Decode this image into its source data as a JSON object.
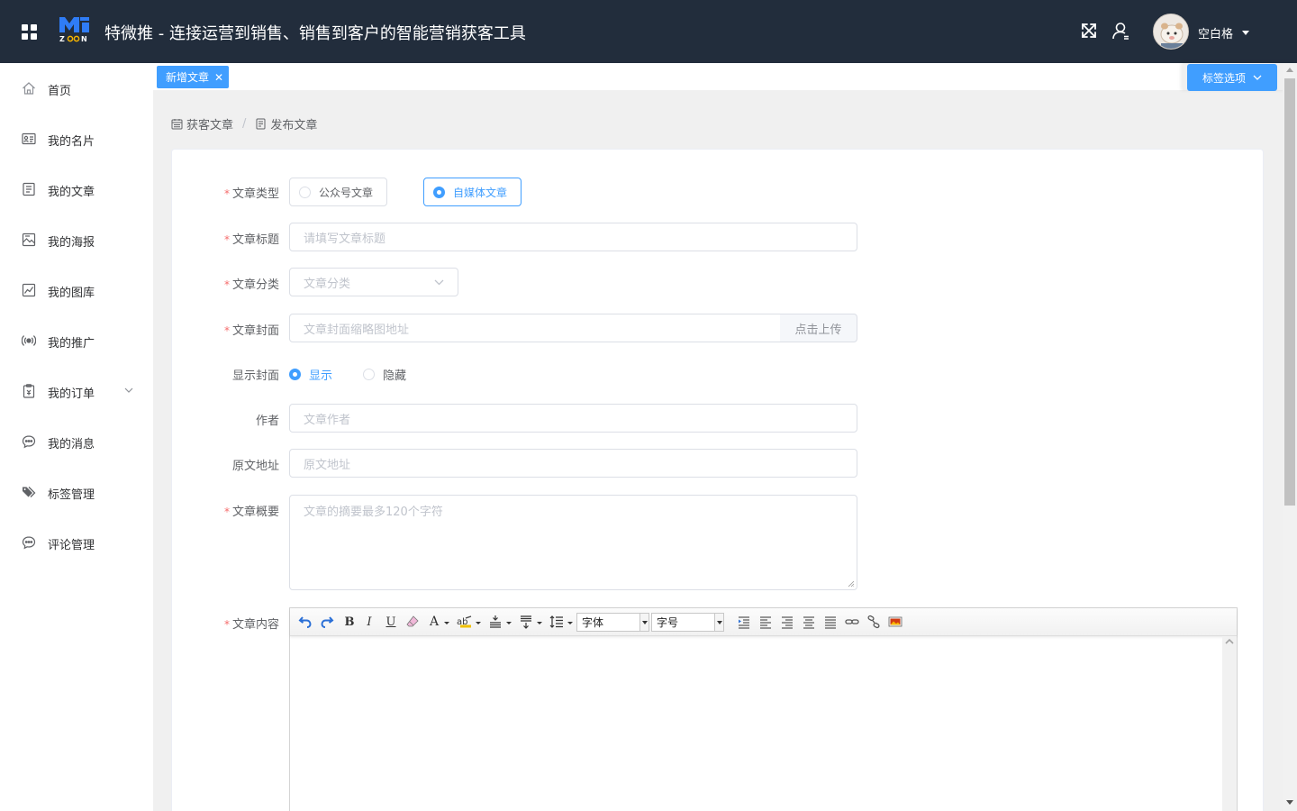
{
  "app": {
    "title": "特微推 - 连接运营到销售、销售到客户的智能营销获客工具",
    "username": "空白格"
  },
  "sidebar": {
    "items": [
      {
        "label": "首页",
        "icon": "home-icon"
      },
      {
        "label": "我的名片",
        "icon": "card-icon"
      },
      {
        "label": "我的文章",
        "icon": "document-icon"
      },
      {
        "label": "我的海报",
        "icon": "poster-icon"
      },
      {
        "label": "我的图库",
        "icon": "chart-icon"
      },
      {
        "label": "我的推广",
        "icon": "broadcast-icon"
      },
      {
        "label": "我的订单",
        "icon": "order-icon"
      },
      {
        "label": "我的消息",
        "icon": "message-icon"
      },
      {
        "label": "标签管理",
        "icon": "tag-icon"
      },
      {
        "label": "评论管理",
        "icon": "comment-icon"
      }
    ]
  },
  "tabs": {
    "active_label": "新增文章",
    "close_glyph": "✕",
    "options_label": "标签选项"
  },
  "breadcrumb": {
    "first": "获客文章",
    "separator": "/",
    "second": "发布文章"
  },
  "form": {
    "type_label": "文章类型",
    "type_options": [
      "公众号文章",
      "自媒体文章"
    ],
    "type_selected": "自媒体文章",
    "title_label": "文章标题",
    "title_placeholder": "请填写文章标题",
    "category_label": "文章分类",
    "category_placeholder": "文章分类",
    "cover_label": "文章封面",
    "cover_placeholder": "文章封面缩略图地址",
    "upload_label": "点击上传",
    "show_cover_label": "显示封面",
    "show_options": [
      "显示",
      "隐藏"
    ],
    "show_selected": "显示",
    "author_label": "作者",
    "author_placeholder": "文章作者",
    "source_label": "原文地址",
    "source_placeholder": "原文地址",
    "summary_label": "文章概要",
    "summary_placeholder": "文章的摘要最多120个字符",
    "content_label": "文章内容",
    "required_mark": "*"
  },
  "editor": {
    "font_family_label": "字体",
    "font_size_label": "字号",
    "bold": "B",
    "italic": "I",
    "underline": "U",
    "font_color": "A"
  },
  "colors": {
    "header_bg": "#222d3c",
    "primary": "#409eff",
    "required": "#f56c6c"
  }
}
